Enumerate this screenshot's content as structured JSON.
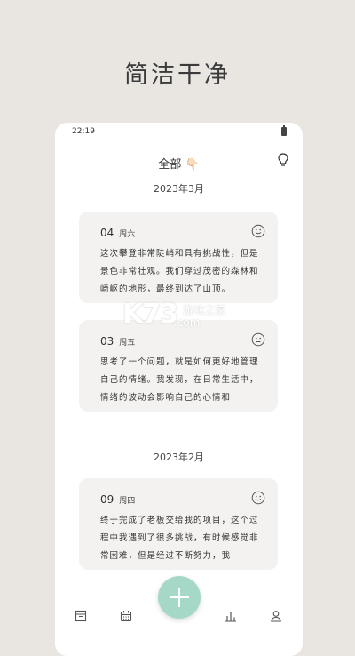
{
  "headline": "简洁干净",
  "status": {
    "time": "22:19"
  },
  "topbar": {
    "title": "全部 👇🏻"
  },
  "sections": [
    {
      "month": "2023年3月",
      "entries": [
        {
          "day": "04",
          "weekday": "周六",
          "text": "这次攀登非常陡峭和具有挑战性，但是景色非常壮观。我们穿过茂密的森林和崎岖的地形，最终到达了山顶。"
        },
        {
          "day": "03",
          "weekday": "周五",
          "text": "思考了一个问题，就是如何更好地管理自己的情绪。我发现，在日常生活中，情绪的波动会影响自己的心情和"
        }
      ]
    },
    {
      "month": "2023年2月",
      "entries": [
        {
          "day": "09",
          "weekday": "周四",
          "text": "终于完成了老板交给我的项目，这个过程中我遇到了很多挑战，有时候感觉非常困难，但是经过不断努力，我"
        }
      ]
    }
  ],
  "watermark": {
    "brand": "K73",
    "cn": "游戏之家",
    "com": ".com"
  },
  "colors": {
    "background": "#e9e6e2",
    "card": "#f3f2f0",
    "fab": "#a6d8c8"
  },
  "nav": [
    "archive-icon",
    "calendar-icon",
    "add-button",
    "stats-icon",
    "profile-icon"
  ]
}
